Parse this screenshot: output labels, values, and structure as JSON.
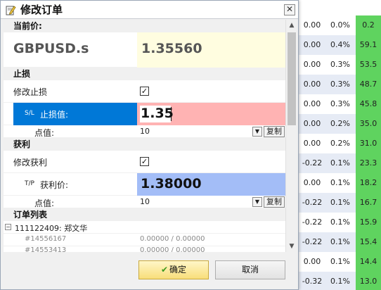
{
  "dialog": {
    "title": "修改订单",
    "close_label": "✕"
  },
  "current_price": {
    "header": "当前价:",
    "symbol": "GBPUSD.s",
    "price": "1.35560"
  },
  "stop_loss": {
    "header": "止损",
    "modify_label": "修改止损",
    "checked": "✓",
    "tag": "S/L",
    "value_label": "止损值:",
    "value": "1.35",
    "points_label": "点值:",
    "points_value": "10",
    "copy_label": "复制"
  },
  "take_profit": {
    "header": "获利",
    "modify_label": "修改获利",
    "checked": "✓",
    "tag": "T/P",
    "value_label": "获利价:",
    "value": "1.38000",
    "points_label": "点值:",
    "points_value": "10",
    "copy_label": "复制"
  },
  "order_list": {
    "header": "订单列表",
    "expand_glyph": "−",
    "group_label": "111122409: 郑文华",
    "orders": [
      {
        "id": "#14556167",
        "sl_tp": "0.00000 / 0.00000"
      },
      {
        "id": "#14553413",
        "sl_tp": "0.00000 / 0.00000"
      }
    ]
  },
  "buttons": {
    "ok_label": "确定",
    "cancel_label": "取消"
  },
  "background_grid": [
    {
      "a": "0.00",
      "b": "0.0%",
      "c": "0.2"
    },
    {
      "a": "0.00",
      "b": "0.4%",
      "c": "59.1"
    },
    {
      "a": "0.00",
      "b": "0.3%",
      "c": "53.5"
    },
    {
      "a": "0.00",
      "b": "0.3%",
      "c": "48.7"
    },
    {
      "a": "0.00",
      "b": "0.3%",
      "c": "45.8"
    },
    {
      "a": "0.00",
      "b": "0.2%",
      "c": "35.0"
    },
    {
      "a": "0.00",
      "b": "0.2%",
      "c": "31.0"
    },
    {
      "a": "-0.22",
      "b": "0.1%",
      "c": "23.3"
    },
    {
      "a": "0.00",
      "b": "0.1%",
      "c": "18.2"
    },
    {
      "a": "-0.22",
      "b": "0.1%",
      "c": "16.7"
    },
    {
      "a": "-0.22",
      "b": "0.1%",
      "c": "15.9"
    },
    {
      "a": "-0.22",
      "b": "0.1%",
      "c": "15.4"
    },
    {
      "a": "0.00",
      "b": "0.1%",
      "c": "14.4"
    },
    {
      "a": "-0.32",
      "b": "0.1%",
      "c": "13.0"
    }
  ],
  "colors": {
    "price_bg": "#fffde0",
    "sl_label_bg": "#0078d7",
    "sl_value_bg": "#ffb3b3",
    "tp_value_bg": "#a3bdf7",
    "grid_green": "#5fd35f"
  }
}
